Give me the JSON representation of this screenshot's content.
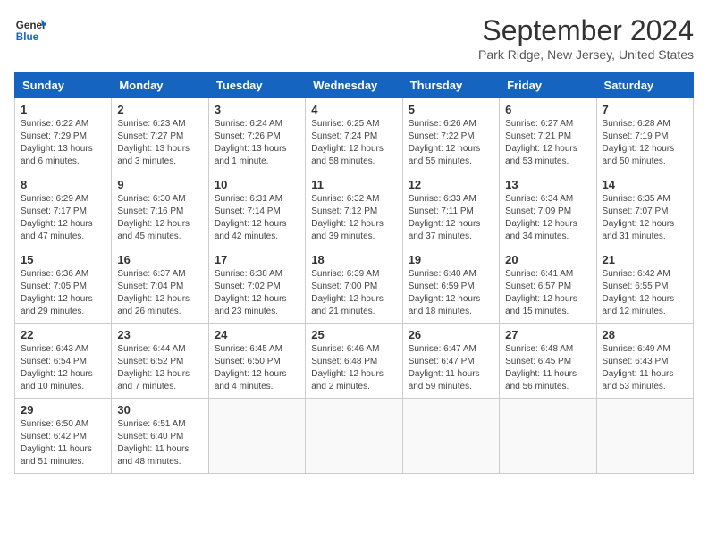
{
  "header": {
    "logo_line1": "General",
    "logo_line2": "Blue",
    "month_title": "September 2024",
    "location": "Park Ridge, New Jersey, United States"
  },
  "days_of_week": [
    "Sunday",
    "Monday",
    "Tuesday",
    "Wednesday",
    "Thursday",
    "Friday",
    "Saturday"
  ],
  "weeks": [
    [
      {
        "day": "1",
        "text": "Sunrise: 6:22 AM\nSunset: 7:29 PM\nDaylight: 13 hours\nand 6 minutes."
      },
      {
        "day": "2",
        "text": "Sunrise: 6:23 AM\nSunset: 7:27 PM\nDaylight: 13 hours\nand 3 minutes."
      },
      {
        "day": "3",
        "text": "Sunrise: 6:24 AM\nSunset: 7:26 PM\nDaylight: 13 hours\nand 1 minute."
      },
      {
        "day": "4",
        "text": "Sunrise: 6:25 AM\nSunset: 7:24 PM\nDaylight: 12 hours\nand 58 minutes."
      },
      {
        "day": "5",
        "text": "Sunrise: 6:26 AM\nSunset: 7:22 PM\nDaylight: 12 hours\nand 55 minutes."
      },
      {
        "day": "6",
        "text": "Sunrise: 6:27 AM\nSunset: 7:21 PM\nDaylight: 12 hours\nand 53 minutes."
      },
      {
        "day": "7",
        "text": "Sunrise: 6:28 AM\nSunset: 7:19 PM\nDaylight: 12 hours\nand 50 minutes."
      }
    ],
    [
      {
        "day": "8",
        "text": "Sunrise: 6:29 AM\nSunset: 7:17 PM\nDaylight: 12 hours\nand 47 minutes."
      },
      {
        "day": "9",
        "text": "Sunrise: 6:30 AM\nSunset: 7:16 PM\nDaylight: 12 hours\nand 45 minutes."
      },
      {
        "day": "10",
        "text": "Sunrise: 6:31 AM\nSunset: 7:14 PM\nDaylight: 12 hours\nand 42 minutes."
      },
      {
        "day": "11",
        "text": "Sunrise: 6:32 AM\nSunset: 7:12 PM\nDaylight: 12 hours\nand 39 minutes."
      },
      {
        "day": "12",
        "text": "Sunrise: 6:33 AM\nSunset: 7:11 PM\nDaylight: 12 hours\nand 37 minutes."
      },
      {
        "day": "13",
        "text": "Sunrise: 6:34 AM\nSunset: 7:09 PM\nDaylight: 12 hours\nand 34 minutes."
      },
      {
        "day": "14",
        "text": "Sunrise: 6:35 AM\nSunset: 7:07 PM\nDaylight: 12 hours\nand 31 minutes."
      }
    ],
    [
      {
        "day": "15",
        "text": "Sunrise: 6:36 AM\nSunset: 7:05 PM\nDaylight: 12 hours\nand 29 minutes."
      },
      {
        "day": "16",
        "text": "Sunrise: 6:37 AM\nSunset: 7:04 PM\nDaylight: 12 hours\nand 26 minutes."
      },
      {
        "day": "17",
        "text": "Sunrise: 6:38 AM\nSunset: 7:02 PM\nDaylight: 12 hours\nand 23 minutes."
      },
      {
        "day": "18",
        "text": "Sunrise: 6:39 AM\nSunset: 7:00 PM\nDaylight: 12 hours\nand 21 minutes."
      },
      {
        "day": "19",
        "text": "Sunrise: 6:40 AM\nSunset: 6:59 PM\nDaylight: 12 hours\nand 18 minutes."
      },
      {
        "day": "20",
        "text": "Sunrise: 6:41 AM\nSunset: 6:57 PM\nDaylight: 12 hours\nand 15 minutes."
      },
      {
        "day": "21",
        "text": "Sunrise: 6:42 AM\nSunset: 6:55 PM\nDaylight: 12 hours\nand 12 minutes."
      }
    ],
    [
      {
        "day": "22",
        "text": "Sunrise: 6:43 AM\nSunset: 6:54 PM\nDaylight: 12 hours\nand 10 minutes."
      },
      {
        "day": "23",
        "text": "Sunrise: 6:44 AM\nSunset: 6:52 PM\nDaylight: 12 hours\nand 7 minutes."
      },
      {
        "day": "24",
        "text": "Sunrise: 6:45 AM\nSunset: 6:50 PM\nDaylight: 12 hours\nand 4 minutes."
      },
      {
        "day": "25",
        "text": "Sunrise: 6:46 AM\nSunset: 6:48 PM\nDaylight: 12 hours\nand 2 minutes."
      },
      {
        "day": "26",
        "text": "Sunrise: 6:47 AM\nSunset: 6:47 PM\nDaylight: 11 hours\nand 59 minutes."
      },
      {
        "day": "27",
        "text": "Sunrise: 6:48 AM\nSunset: 6:45 PM\nDaylight: 11 hours\nand 56 minutes."
      },
      {
        "day": "28",
        "text": "Sunrise: 6:49 AM\nSunset: 6:43 PM\nDaylight: 11 hours\nand 53 minutes."
      }
    ],
    [
      {
        "day": "29",
        "text": "Sunrise: 6:50 AM\nSunset: 6:42 PM\nDaylight: 11 hours\nand 51 minutes."
      },
      {
        "day": "30",
        "text": "Sunrise: 6:51 AM\nSunset: 6:40 PM\nDaylight: 11 hours\nand 48 minutes."
      },
      {
        "day": "",
        "text": ""
      },
      {
        "day": "",
        "text": ""
      },
      {
        "day": "",
        "text": ""
      },
      {
        "day": "",
        "text": ""
      },
      {
        "day": "",
        "text": ""
      }
    ]
  ]
}
